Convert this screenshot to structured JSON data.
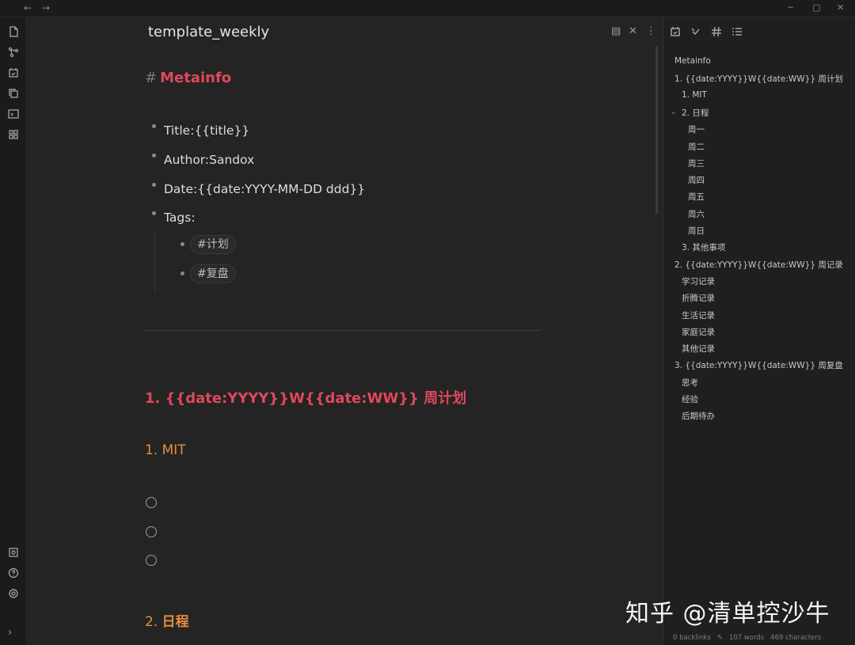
{
  "window": {
    "nav_back": "←",
    "nav_forward": "→",
    "minimize": "─",
    "maximize": "▢",
    "close": "✕"
  },
  "ribbon": {
    "collapse": "›"
  },
  "editor": {
    "title": "template_weekly",
    "heading_hash": "#",
    "metainfo_heading": "Metainfo",
    "meta_items": [
      "Title:{{title}}",
      "Author:Sandox",
      "Date:{{date:YYYY-MM-DD ddd}}",
      "Tags:"
    ],
    "tags": [
      "#计划",
      "#复盘"
    ],
    "section1_heading": "1. {{date:YYYY}}W{{date:WW}} 周计划",
    "mit_heading": "1. MIT",
    "schedule_heading_num": "2.",
    "schedule_heading_text": "日程",
    "actions": {
      "reading": "▤",
      "close": "✕",
      "more": "⋮"
    }
  },
  "outline": [
    {
      "text": "Metainfo",
      "level": 0
    },
    {
      "text": "1. {{date:YYYY}}W{{date:WW}} 周计划",
      "level": 0
    },
    {
      "text": "1. MIT",
      "level": 1
    },
    {
      "text": "2. 日程",
      "level": 1
    },
    {
      "text": "周一",
      "level": 2
    },
    {
      "text": "周二",
      "level": 2
    },
    {
      "text": "周三",
      "level": 2
    },
    {
      "text": "周四",
      "level": 2
    },
    {
      "text": "周五",
      "level": 2
    },
    {
      "text": "周六",
      "level": 2
    },
    {
      "text": "周日",
      "level": 2
    },
    {
      "text": "3. 其他事项",
      "level": 1
    },
    {
      "text": "2. {{date:YYYY}}W{{date:WW}} 周记录",
      "level": 0
    },
    {
      "text": "学习记录",
      "level": 1
    },
    {
      "text": "折腾记录",
      "level": 1
    },
    {
      "text": "生活记录",
      "level": 1
    },
    {
      "text": "家庭记录",
      "level": 1
    },
    {
      "text": "其他记录",
      "level": 1
    },
    {
      "text": "3. {{date:YYYY}}W{{date:WW}} 周复盘",
      "level": 0
    },
    {
      "text": "思考",
      "level": 1
    },
    {
      "text": "经验",
      "level": 1
    },
    {
      "text": "后期待办",
      "level": 1
    }
  ],
  "outline_chevron": "⌄",
  "status_bar": {
    "backlinks": "0 backlinks",
    "words": "107 words",
    "characters": "469 characters"
  },
  "watermark": "知乎 @清单控沙牛",
  "colors": {
    "heading_red": "#e0485c",
    "heading_orange": "#e88d3b",
    "background": "#242424"
  }
}
